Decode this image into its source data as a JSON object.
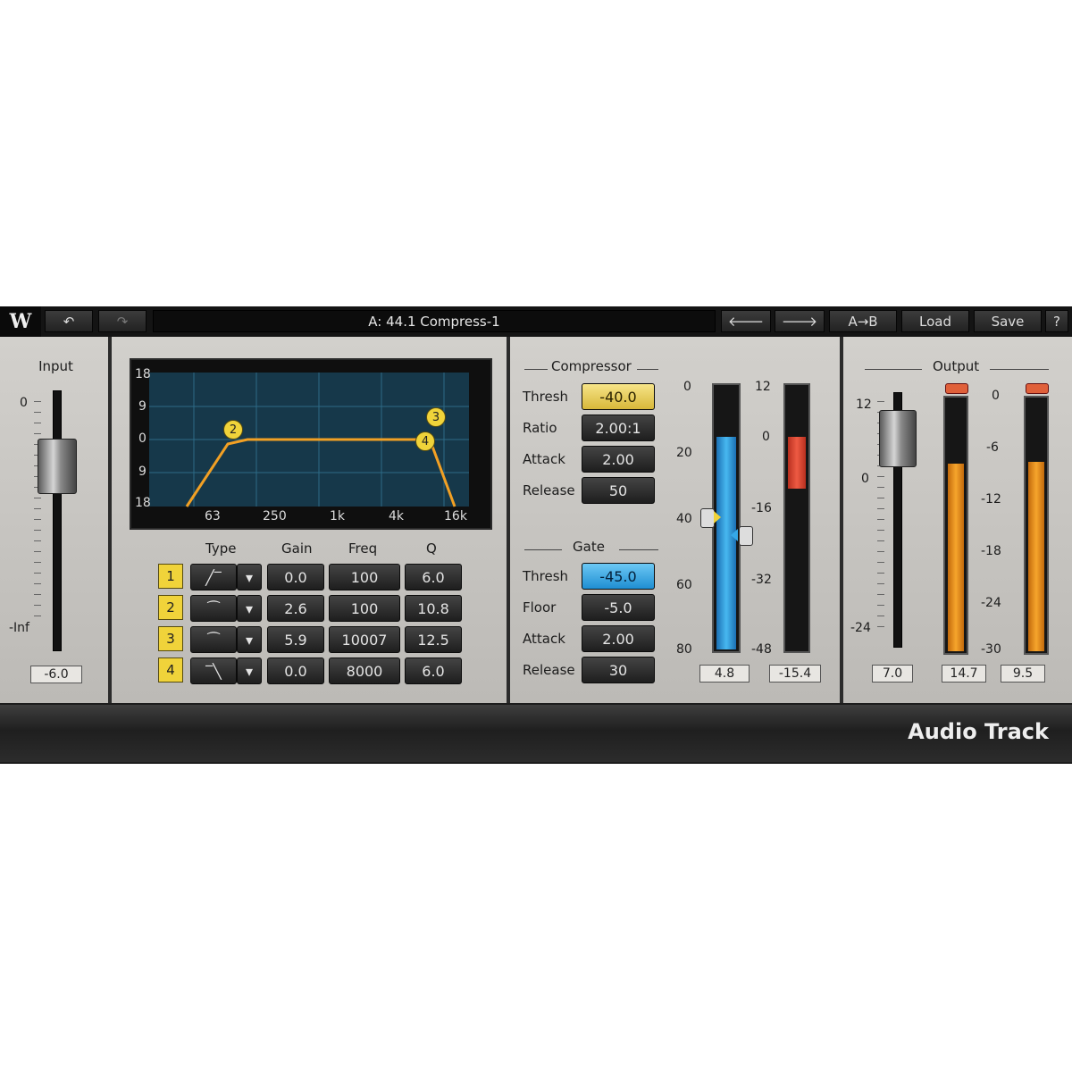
{
  "toolbar": {
    "logo": "W",
    "undo_icon": "undo-icon",
    "redo_icon": "redo-icon",
    "preset_name": "A: 44.1 Compress-1",
    "prev_icon": "arrow-left-icon",
    "next_icon": "arrow-right-icon",
    "ab_label": "A→B",
    "load_label": "Load",
    "save_label": "Save",
    "help_label": "?"
  },
  "input": {
    "title": "Input",
    "scale_top": "0",
    "scale_bottom": "-Inf",
    "value": "-6.0"
  },
  "eq": {
    "y_labels": [
      "18",
      "9",
      "0",
      "9",
      "18"
    ],
    "x_labels": [
      "63",
      "250",
      "1k",
      "4k",
      "16k"
    ],
    "headers": {
      "type": "Type",
      "gain": "Gain",
      "freq": "Freq",
      "q": "Q"
    },
    "bands": [
      {
        "num": "1",
        "gain": "0.0",
        "freq": "100",
        "q": "6.0"
      },
      {
        "num": "2",
        "gain": "2.6",
        "freq": "100",
        "q": "10.8"
      },
      {
        "num": "3",
        "gain": "5.9",
        "freq": "10007",
        "q": "12.5"
      },
      {
        "num": "4",
        "gain": "0.0",
        "freq": "8000",
        "q": "6.0"
      }
    ],
    "markers": [
      "2",
      "3",
      "4"
    ]
  },
  "compressor": {
    "title": "Compressor",
    "thresh_label": "Thresh",
    "thresh": "-40.0",
    "ratio_label": "Ratio",
    "ratio": "2.00:1",
    "attack_label": "Attack",
    "attack": "2.00",
    "release_label": "Release",
    "release": "50"
  },
  "gate": {
    "title": "Gate",
    "thresh_label": "Thresh",
    "thresh": "-45.0",
    "floor_label": "Floor",
    "floor": "-5.0",
    "attack_label": "Attack",
    "attack": "2.00",
    "release_label": "Release",
    "release": "30"
  },
  "dyn_meters": {
    "left_scale": [
      "0",
      "20",
      "40",
      "60",
      "80"
    ],
    "right_scale": [
      "12",
      "0",
      "-16",
      "-32",
      "-48"
    ],
    "left_value": "4.8",
    "right_value": "-15.4"
  },
  "output": {
    "title": "Output",
    "fader_scale": [
      "12",
      "0",
      "-24"
    ],
    "meter_scale": [
      "0",
      "-6",
      "-12",
      "-18",
      "-24",
      "-30"
    ],
    "fader_value": "7.0",
    "meter_l_value": "14.7",
    "meter_r_value": "9.5"
  },
  "footer": {
    "label": "Audio Track"
  },
  "colors": {
    "yellow": "#f0d33a",
    "blue": "#35a8e8",
    "orange": "#f29a20",
    "red": "#e04b35"
  }
}
